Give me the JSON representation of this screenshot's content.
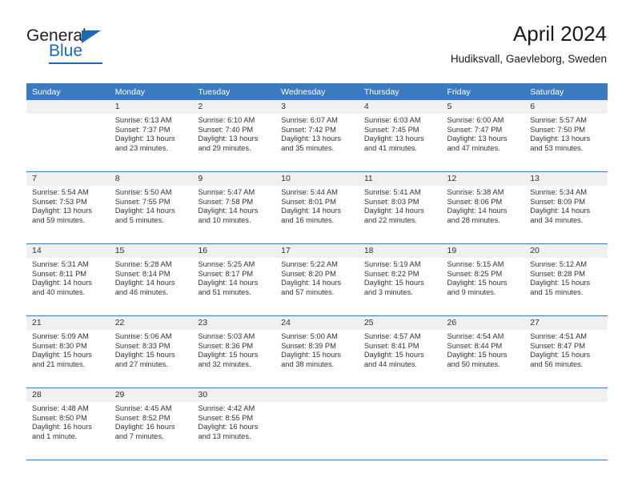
{
  "brand": {
    "name_part1": "General",
    "name_part2": "Blue",
    "accent_color": "#1b6ab3"
  },
  "header": {
    "title": "April 2024",
    "subtitle": "Hudiksvall, Gaevleborg, Sweden"
  },
  "theme": {
    "header_bar_color": "#3a7ac0",
    "daynum_bg": "#f0f0f0",
    "text_color": "#333333"
  },
  "weekday_headers": [
    "Sunday",
    "Monday",
    "Tuesday",
    "Wednesday",
    "Thursday",
    "Friday",
    "Saturday"
  ],
  "labels": {
    "sunrise_prefix": "Sunrise:",
    "sunset_prefix": "Sunset:",
    "daylight_prefix": "Daylight:"
  },
  "weeks": [
    [
      {
        "day": "",
        "empty": true,
        "sunrise": "",
        "sunset": "",
        "daylight_line1": "",
        "daylight_line2": ""
      },
      {
        "day": "1",
        "sunrise": "Sunrise: 6:13 AM",
        "sunset": "Sunset: 7:37 PM",
        "daylight_line1": "Daylight: 13 hours",
        "daylight_line2": "and 23 minutes."
      },
      {
        "day": "2",
        "sunrise": "Sunrise: 6:10 AM",
        "sunset": "Sunset: 7:40 PM",
        "daylight_line1": "Daylight: 13 hours",
        "daylight_line2": "and 29 minutes."
      },
      {
        "day": "3",
        "sunrise": "Sunrise: 6:07 AM",
        "sunset": "Sunset: 7:42 PM",
        "daylight_line1": "Daylight: 13 hours",
        "daylight_line2": "and 35 minutes."
      },
      {
        "day": "4",
        "sunrise": "Sunrise: 6:03 AM",
        "sunset": "Sunset: 7:45 PM",
        "daylight_line1": "Daylight: 13 hours",
        "daylight_line2": "and 41 minutes."
      },
      {
        "day": "5",
        "sunrise": "Sunrise: 6:00 AM",
        "sunset": "Sunset: 7:47 PM",
        "daylight_line1": "Daylight: 13 hours",
        "daylight_line2": "and 47 minutes."
      },
      {
        "day": "6",
        "sunrise": "Sunrise: 5:57 AM",
        "sunset": "Sunset: 7:50 PM",
        "daylight_line1": "Daylight: 13 hours",
        "daylight_line2": "and 53 minutes."
      }
    ],
    [
      {
        "day": "7",
        "sunrise": "Sunrise: 5:54 AM",
        "sunset": "Sunset: 7:53 PM",
        "daylight_line1": "Daylight: 13 hours",
        "daylight_line2": "and 59 minutes."
      },
      {
        "day": "8",
        "sunrise": "Sunrise: 5:50 AM",
        "sunset": "Sunset: 7:55 PM",
        "daylight_line1": "Daylight: 14 hours",
        "daylight_line2": "and 5 minutes."
      },
      {
        "day": "9",
        "sunrise": "Sunrise: 5:47 AM",
        "sunset": "Sunset: 7:58 PM",
        "daylight_line1": "Daylight: 14 hours",
        "daylight_line2": "and 10 minutes."
      },
      {
        "day": "10",
        "sunrise": "Sunrise: 5:44 AM",
        "sunset": "Sunset: 8:01 PM",
        "daylight_line1": "Daylight: 14 hours",
        "daylight_line2": "and 16 minutes."
      },
      {
        "day": "11",
        "sunrise": "Sunrise: 5:41 AM",
        "sunset": "Sunset: 8:03 PM",
        "daylight_line1": "Daylight: 14 hours",
        "daylight_line2": "and 22 minutes."
      },
      {
        "day": "12",
        "sunrise": "Sunrise: 5:38 AM",
        "sunset": "Sunset: 8:06 PM",
        "daylight_line1": "Daylight: 14 hours",
        "daylight_line2": "and 28 minutes."
      },
      {
        "day": "13",
        "sunrise": "Sunrise: 5:34 AM",
        "sunset": "Sunset: 8:09 PM",
        "daylight_line1": "Daylight: 14 hours",
        "daylight_line2": "and 34 minutes."
      }
    ],
    [
      {
        "day": "14",
        "sunrise": "Sunrise: 5:31 AM",
        "sunset": "Sunset: 8:11 PM",
        "daylight_line1": "Daylight: 14 hours",
        "daylight_line2": "and 40 minutes."
      },
      {
        "day": "15",
        "sunrise": "Sunrise: 5:28 AM",
        "sunset": "Sunset: 8:14 PM",
        "daylight_line1": "Daylight: 14 hours",
        "daylight_line2": "and 46 minutes."
      },
      {
        "day": "16",
        "sunrise": "Sunrise: 5:25 AM",
        "sunset": "Sunset: 8:17 PM",
        "daylight_line1": "Daylight: 14 hours",
        "daylight_line2": "and 51 minutes."
      },
      {
        "day": "17",
        "sunrise": "Sunrise: 5:22 AM",
        "sunset": "Sunset: 8:20 PM",
        "daylight_line1": "Daylight: 14 hours",
        "daylight_line2": "and 57 minutes."
      },
      {
        "day": "18",
        "sunrise": "Sunrise: 5:19 AM",
        "sunset": "Sunset: 8:22 PM",
        "daylight_line1": "Daylight: 15 hours",
        "daylight_line2": "and 3 minutes."
      },
      {
        "day": "19",
        "sunrise": "Sunrise: 5:15 AM",
        "sunset": "Sunset: 8:25 PM",
        "daylight_line1": "Daylight: 15 hours",
        "daylight_line2": "and 9 minutes."
      },
      {
        "day": "20",
        "sunrise": "Sunrise: 5:12 AM",
        "sunset": "Sunset: 8:28 PM",
        "daylight_line1": "Daylight: 15 hours",
        "daylight_line2": "and 15 minutes."
      }
    ],
    [
      {
        "day": "21",
        "sunrise": "Sunrise: 5:09 AM",
        "sunset": "Sunset: 8:30 PM",
        "daylight_line1": "Daylight: 15 hours",
        "daylight_line2": "and 21 minutes."
      },
      {
        "day": "22",
        "sunrise": "Sunrise: 5:06 AM",
        "sunset": "Sunset: 8:33 PM",
        "daylight_line1": "Daylight: 15 hours",
        "daylight_line2": "and 27 minutes."
      },
      {
        "day": "23",
        "sunrise": "Sunrise: 5:03 AM",
        "sunset": "Sunset: 8:36 PM",
        "daylight_line1": "Daylight: 15 hours",
        "daylight_line2": "and 32 minutes."
      },
      {
        "day": "24",
        "sunrise": "Sunrise: 5:00 AM",
        "sunset": "Sunset: 8:39 PM",
        "daylight_line1": "Daylight: 15 hours",
        "daylight_line2": "and 38 minutes."
      },
      {
        "day": "25",
        "sunrise": "Sunrise: 4:57 AM",
        "sunset": "Sunset: 8:41 PM",
        "daylight_line1": "Daylight: 15 hours",
        "daylight_line2": "and 44 minutes."
      },
      {
        "day": "26",
        "sunrise": "Sunrise: 4:54 AM",
        "sunset": "Sunset: 8:44 PM",
        "daylight_line1": "Daylight: 15 hours",
        "daylight_line2": "and 50 minutes."
      },
      {
        "day": "27",
        "sunrise": "Sunrise: 4:51 AM",
        "sunset": "Sunset: 8:47 PM",
        "daylight_line1": "Daylight: 15 hours",
        "daylight_line2": "and 56 minutes."
      }
    ],
    [
      {
        "day": "28",
        "sunrise": "Sunrise: 4:48 AM",
        "sunset": "Sunset: 8:50 PM",
        "daylight_line1": "Daylight: 16 hours",
        "daylight_line2": "and 1 minute."
      },
      {
        "day": "29",
        "sunrise": "Sunrise: 4:45 AM",
        "sunset": "Sunset: 8:52 PM",
        "daylight_line1": "Daylight: 16 hours",
        "daylight_line2": "and 7 minutes."
      },
      {
        "day": "30",
        "sunrise": "Sunrise: 4:42 AM",
        "sunset": "Sunset: 8:55 PM",
        "daylight_line1": "Daylight: 16 hours",
        "daylight_line2": "and 13 minutes."
      },
      {
        "day": "",
        "empty": true,
        "sunrise": "",
        "sunset": "",
        "daylight_line1": "",
        "daylight_line2": ""
      },
      {
        "day": "",
        "empty": true,
        "sunrise": "",
        "sunset": "",
        "daylight_line1": "",
        "daylight_line2": ""
      },
      {
        "day": "",
        "empty": true,
        "sunrise": "",
        "sunset": "",
        "daylight_line1": "",
        "daylight_line2": ""
      },
      {
        "day": "",
        "empty": true,
        "sunrise": "",
        "sunset": "",
        "daylight_line1": "",
        "daylight_line2": ""
      }
    ]
  ]
}
